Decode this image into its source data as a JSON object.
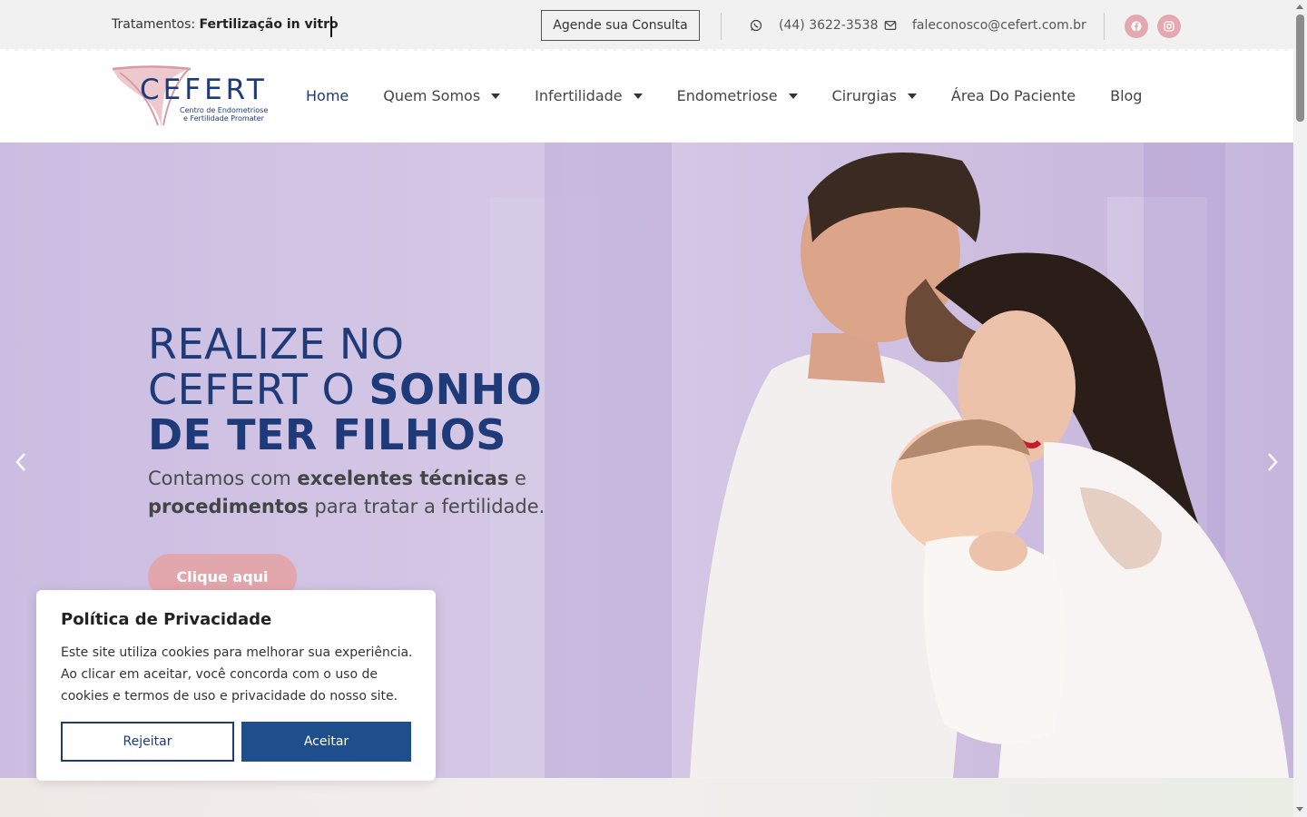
{
  "topbar": {
    "treatment_label": "Tratamentos:",
    "treatment_value": "Fertilização in vitro",
    "cta_label": "Agende sua Consulta",
    "phone": "(44) 3622-3538",
    "email": "faleconosco@cefert.com.br",
    "icons": [
      "whatsapp-icon",
      "envelope-icon",
      "facebook-icon",
      "instagram-icon"
    ]
  },
  "header": {
    "logo_word": "CEFERT",
    "logo_sub1": "Centro de Endometriose",
    "logo_sub2": "e Fertilidade Promater",
    "nav": [
      {
        "label": "Home",
        "active": true,
        "dropdown": false
      },
      {
        "label": "Quem Somos",
        "active": false,
        "dropdown": true
      },
      {
        "label": "Infertilidade",
        "active": false,
        "dropdown": true
      },
      {
        "label": "Endometriose",
        "active": false,
        "dropdown": true
      },
      {
        "label": "Cirurgias",
        "active": false,
        "dropdown": true
      },
      {
        "label": "Área Do Paciente",
        "active": false,
        "dropdown": false
      },
      {
        "label": "Blog",
        "active": false,
        "dropdown": false
      }
    ]
  },
  "hero": {
    "title_line1": "REALIZE NO",
    "title_line2_plain": "CEFERT O ",
    "title_line2_bold": "SONHO",
    "title_line3_bold": "DE TER FILHOS",
    "sub_1": "Contamos com ",
    "sub_bold_1": "excelentes técnicas",
    "sub_2": " e ",
    "sub_bold_2": "procedimentos",
    "sub_3": " para tratar a fertilidade.",
    "button_label": "Clique aqui"
  },
  "cookie": {
    "title": "Política de Privacidade",
    "text": "Este site utiliza cookies para melhorar sua experiência. Ao clicar em aceitar, você concorda com o uso de cookies e termos de uso e privacidade do nosso site.",
    "reject_label": "Rejeitar",
    "accept_label": "Aceitar"
  },
  "colors": {
    "brand_blue": "#1e3a78",
    "accent_pink": "#e2a6ad",
    "accept_blue": "#1e4e8c",
    "hero_lavender": "#cbbde1"
  }
}
